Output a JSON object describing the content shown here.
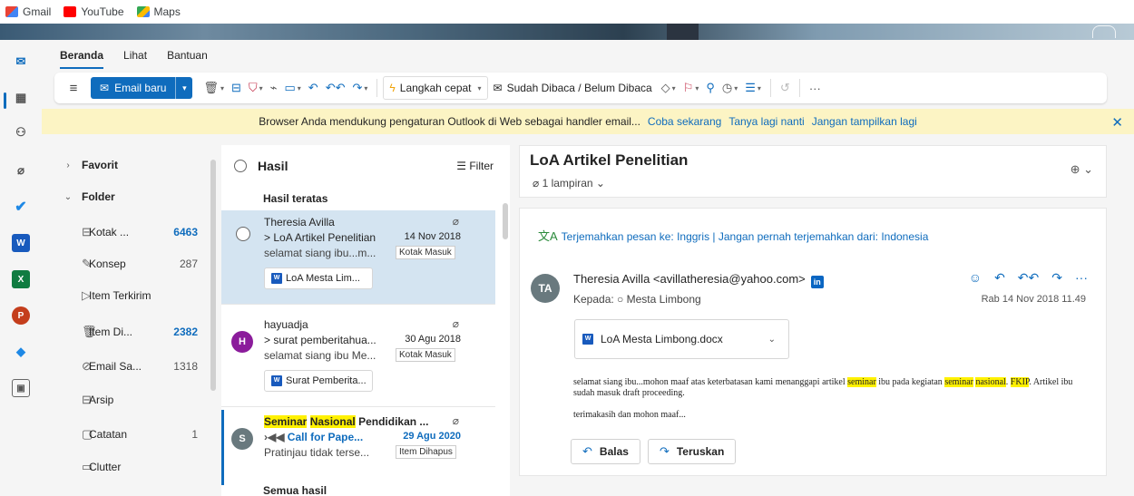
{
  "bookmarks": [
    {
      "label": "Gmail",
      "color": "#ea4335"
    },
    {
      "label": "YouTube",
      "color": "#ff0000"
    },
    {
      "label": "Maps",
      "color": "#34a853"
    }
  ],
  "ribbon": {
    "tabs": [
      "Beranda",
      "Lihat",
      "Bantuan"
    ],
    "active_tab": "Beranda",
    "new_mail_label": "Email baru",
    "quick_steps_label": "Langkah cepat",
    "read_unread_label": "Sudah Dibaca / Belum Dibaca"
  },
  "infobar": {
    "message": "Browser Anda mendukung pengaturan Outlook di Web sebagai handler email...",
    "try_now": "Coba sekarang",
    "ask_later": "Tanya lagi nanti",
    "dont_show": "Jangan tampilkan lagi"
  },
  "folders": {
    "favorites_label": "Favorit",
    "folder_label": "Folder",
    "items": [
      {
        "label": "Kotak ...",
        "count": "6463",
        "icon": "inbox-icon"
      },
      {
        "label": "Konsep",
        "count": "287",
        "icon": "draft-icon"
      },
      {
        "label": "Item Terkirim",
        "count": "",
        "icon": "sent-icon"
      },
      {
        "label": "Item Di...",
        "count": "2382",
        "icon": "trash-icon"
      },
      {
        "label": "Email Sa...",
        "count": "1318",
        "icon": "junk-icon"
      },
      {
        "label": "Arsip",
        "count": "",
        "icon": "archive-icon"
      },
      {
        "label": "Catatan",
        "count": "1",
        "icon": "notes-icon"
      },
      {
        "label": "Clutter",
        "count": "",
        "icon": "folder-icon"
      }
    ]
  },
  "list": {
    "title": "Hasil",
    "filter_label": "Filter",
    "top_results_label": "Hasil teratas",
    "all_results_label": "Semua hasil",
    "messages": [
      {
        "from": "Theresia Avilla",
        "subject": "> LoA Artikel Penelitian",
        "date": "14 Nov 2018",
        "preview": "selamat siang ibu...m...",
        "tag": "Kotak Masuk",
        "attachment": "LoA Mesta Lim..."
      },
      {
        "from": "hayuadja",
        "subject": "> surat pemberitahua...",
        "date": "30 Agu 2018",
        "preview": "selamat siang ibu Me...",
        "tag": "Kotak Masuk",
        "attachment": "Surat Pemberita...",
        "avatar": "H"
      },
      {
        "from_hl1": "Seminar",
        "from_hl2": "Nasional",
        "from_rest": "Pendidikan ...",
        "subject": "Call for Pape...",
        "date": "29 Agu 2020",
        "preview": "Pratinjau tidak terse...",
        "tag": "Item Dihapus",
        "avatar": "S"
      }
    ]
  },
  "reading": {
    "subject": "LoA Artikel Penelitian",
    "attachments_count": "1 lampiran",
    "translate_text": "Terjemahkan pesan ke: Inggris | Jangan pernah terjemahkan dari: Indonesia",
    "sender_initials": "TA",
    "sender": "Theresia Avilla <avillatheresia@yahoo.com>",
    "to": "Kepada: ○ Mesta Limbong",
    "date": "Rab 14 Nov 2018 11.49",
    "attachment_name": "LoA Mesta Limbong.docx",
    "body_1a": "selamat siang ibu...mohon maaf atas keterbatasan kami menanggapi artikel ",
    "body_hl_seminar": "seminar",
    "body_1b": " ibu pada kegiatan ",
    "body_hl_seminar2": "seminar",
    "body_hl_nasional": "nasional",
    "body_hl_fkip": "FKIP",
    "body_1c": ". Artikel ibu sudah masuk draft proceeding.",
    "body_2": "terimakasih dan mohon maaf...",
    "reply_label": "Balas",
    "forward_label": "Teruskan"
  }
}
